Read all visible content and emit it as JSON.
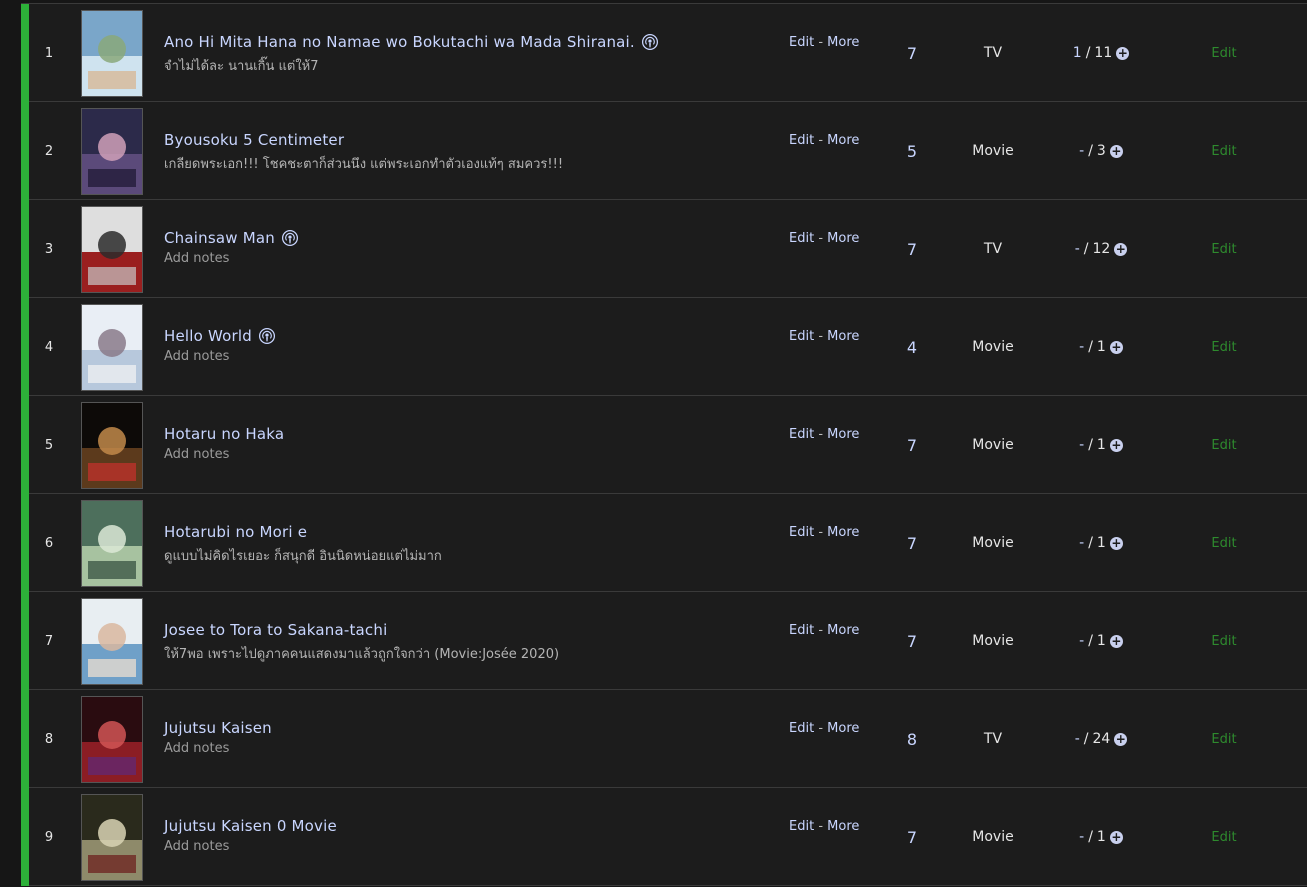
{
  "colors": {
    "status_bar": "#2db039",
    "link": "#c9d6ff",
    "edit_green": "#2e8a2e",
    "row_bg": "#1c1c1c"
  },
  "labels": {
    "edit": "Edit",
    "more": "More",
    "separator": " - ",
    "row_edit": "Edit"
  },
  "entries": [
    {
      "num": "1",
      "title": "Ano Hi Mita Hana no Namae wo Bokutachi wa Mada Shiranai.",
      "podcast_icon": true,
      "notes": "จำไม่ได้ละ นานเกิ๊น แต่ให้7",
      "notes_placeholder": false,
      "score": "7",
      "type": "TV",
      "watched": "1",
      "total": "11"
    },
    {
      "num": "2",
      "title": "Byousoku 5 Centimeter",
      "podcast_icon": false,
      "notes": "เกลียดพระเอก!!! โชคชะตาก็ส่วนนึง แต่พระเอกทำตัวเองแท้ๆ สมควร!!!",
      "notes_placeholder": false,
      "score": "5",
      "type": "Movie",
      "watched": "-",
      "total": "3"
    },
    {
      "num": "3",
      "title": "Chainsaw Man",
      "podcast_icon": true,
      "notes": "Add notes",
      "notes_placeholder": true,
      "score": "7",
      "type": "TV",
      "watched": "-",
      "total": "12"
    },
    {
      "num": "4",
      "title": "Hello World",
      "podcast_icon": true,
      "notes": "Add notes",
      "notes_placeholder": true,
      "score": "4",
      "type": "Movie",
      "watched": "-",
      "total": "1"
    },
    {
      "num": "5",
      "title": "Hotaru no Haka",
      "podcast_icon": false,
      "notes": "Add notes",
      "notes_placeholder": true,
      "score": "7",
      "type": "Movie",
      "watched": "-",
      "total": "1"
    },
    {
      "num": "6",
      "title": "Hotarubi no Mori e",
      "podcast_icon": false,
      "notes": "ดูแบบไม่คิดไรเยอะ ก็สนุกดี อินนิดหน่อยแต่ไม่มาก",
      "notes_placeholder": false,
      "score": "7",
      "type": "Movie",
      "watched": "-",
      "total": "1"
    },
    {
      "num": "7",
      "title": "Josee to Tora to Sakana-tachi",
      "podcast_icon": false,
      "notes": "ให้7พอ เพราะไปดูภาคคนแสดงมาแล้วถูกใจกว่า (Movie:Josée 2020)",
      "notes_placeholder": false,
      "score": "7",
      "type": "Movie",
      "watched": "-",
      "total": "1"
    },
    {
      "num": "8",
      "title": "Jujutsu Kaisen",
      "podcast_icon": false,
      "notes": "Add notes",
      "notes_placeholder": true,
      "score": "8",
      "type": "TV",
      "watched": "-",
      "total": "24"
    },
    {
      "num": "9",
      "title": "Jujutsu Kaisen 0 Movie",
      "podcast_icon": false,
      "notes": "Add notes",
      "notes_placeholder": true,
      "score": "7",
      "type": "Movie",
      "watched": "-",
      "total": "1"
    }
  ],
  "cover_palettes": [
    [
      "#7aa6c9",
      "#cfe3ef",
      "#8aa87a",
      "#d9b28c"
    ],
    [
      "#2c2a4a",
      "#5b4a7a",
      "#d0a0b8",
      "#1b1630"
    ],
    [
      "#dedede",
      "#9a1f1f",
      "#2b2b2b",
      "#c7c7c7"
    ],
    [
      "#e9eef5",
      "#b7c8dc",
      "#8a7a8a",
      "#f4f4f4"
    ],
    [
      "#0d0a08",
      "#5c3a1c",
      "#c28a4a",
      "#c9302c"
    ],
    [
      "#4d6f5c",
      "#a7c2a0",
      "#dce9d6",
      "#2f4a3a"
    ],
    [
      "#e8eef2",
      "#6fa0c8",
      "#d9b7a0",
      "#f5e3d0"
    ],
    [
      "#2a0c10",
      "#8b1d24",
      "#d15555",
      "#5e2a7a"
    ],
    [
      "#2a2a1c",
      "#8e8a6a",
      "#d9d3b4",
      "#6b1a1a"
    ]
  ]
}
